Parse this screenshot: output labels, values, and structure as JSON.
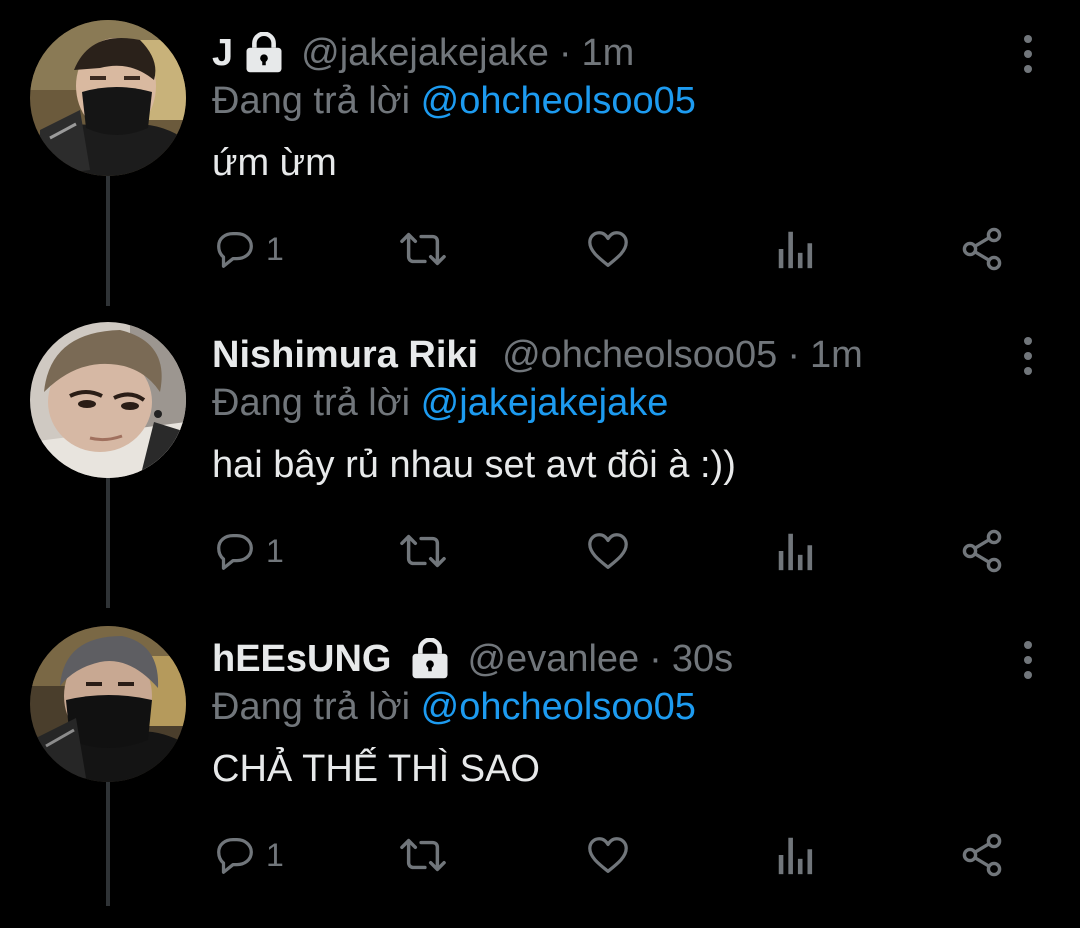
{
  "tweets": [
    {
      "name": "J",
      "locked": true,
      "handle": "@jakejakejake",
      "separator": "·",
      "time": "1m",
      "replying_prefix": "Đang trả lời",
      "replying_to": "@ohcheolsoo05",
      "text": "ứm ừm",
      "reply_count": "1"
    },
    {
      "name": "Nishimura Riki",
      "locked": false,
      "handle": "@ohcheolsoo05",
      "separator": "·",
      "time": "1m",
      "replying_prefix": "Đang trả lời",
      "replying_to": "@jakejakejake",
      "text": "hai bây rủ nhau set avt đôi à :))",
      "reply_count": "1"
    },
    {
      "name": "hEEsUNG",
      "locked": true,
      "handle": "@evanlee",
      "separator": "·",
      "time": "30s",
      "replying_prefix": "Đang trả lời",
      "replying_to": "@ohcheolsoo05",
      "text": "CHẢ THẾ THÌ SAO",
      "reply_count": "1"
    }
  ],
  "icons": {
    "reply": "comment-icon",
    "retweet": "retweet-icon",
    "like": "heart-icon",
    "views": "analytics-icon",
    "share": "share-icon",
    "more": "more-vertical-icon",
    "lock": "lock-icon"
  },
  "colors": {
    "background": "#000000",
    "text": "#e7e9ea",
    "secondary": "#71767b",
    "accent": "#1d9bf0",
    "thread_line": "#2f3336"
  }
}
